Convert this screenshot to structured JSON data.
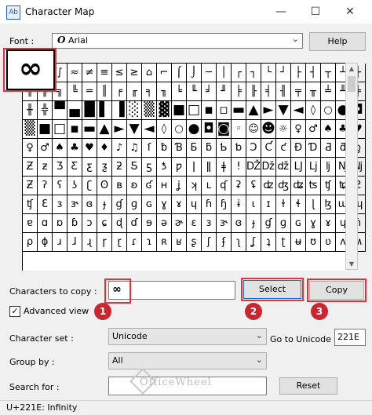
{
  "window": {
    "title": "Character Map",
    "app_icon": "character-map-icon",
    "controls": {
      "minimize": "—",
      "maximize": "☐"
    }
  },
  "font": {
    "label": "Font :",
    "value": "Arial",
    "font_icon": "O"
  },
  "help_label": "Help",
  "magnified_char": "∞",
  "grid_rows": [
    [
      "∞",
      "∩",
      "∫",
      "≈",
      "≠",
      "≡",
      "≤",
      "≥",
      "⌂",
      "⌐",
      "⌠",
      "⌡",
      "─",
      "│",
      "┌",
      "┐",
      "└",
      "┘",
      "├",
      "┤",
      "┬",
      "┴",
      "┼"
    ],
    [
      "╔",
      "╠",
      "╗",
      "╚",
      "═",
      "║",
      "╒",
      "╓",
      "╕",
      "╖",
      "╘",
      "╙",
      "╛",
      "╜",
      "╞",
      "╟",
      "╡",
      "╢",
      "╤",
      "╥",
      "╧",
      "╨",
      "╪"
    ],
    [
      "╫",
      "╬",
      "▀",
      "▄",
      "█",
      "▌",
      "▐",
      "░",
      "▒",
      "▓",
      "■",
      "□",
      "▪",
      "▫",
      "▬",
      "▲",
      "►",
      "▼",
      "◄",
      "◊",
      "○",
      "●",
      "◘"
    ],
    [
      "▒",
      "■",
      "□",
      "▪",
      "▬",
      "▲",
      "►",
      "▼",
      "◄",
      "◊",
      "○",
      "●",
      "◘",
      "◙",
      "◦",
      "☺",
      "☻",
      "☼",
      "♀",
      "♂",
      "♠",
      "♣",
      "♥"
    ],
    [
      "♀",
      "♂",
      "♠",
      "♣",
      "♥",
      "♦",
      "♪",
      "♫",
      "ſ",
      "ƀ",
      "Ɓ",
      "Ƃ",
      "ƃ",
      "Ƅ",
      "ƅ",
      "Ɔ",
      "Ƈ",
      "ƈ",
      "Ɖ",
      "Ɗ",
      "Ƌ",
      "ƌ",
      "ƍ"
    ],
    [
      "Ƶ",
      "ƶ",
      "Ʒ",
      "Ƹ",
      "ƹ",
      "ƺ",
      "ƻ",
      "Ƽ",
      "ƽ",
      "ƾ",
      "ƿ",
      "ǀ",
      "ǁ",
      "ǂ",
      "ǃ",
      "Ǆ",
      "ǅ",
      "ǆ",
      "Ǉ",
      "ǈ",
      "ǉ",
      "Ǌ",
      "ǋ"
    ],
    [
      "Ƶ",
      "ʔ",
      "ʕ",
      "ʖ",
      "ʗ",
      "ʘ",
      "ʙ",
      "ʚ",
      "ʛ",
      "ʜ",
      "ʝ",
      "ʞ",
      "ʟ",
      "ʠ",
      "ʡ",
      "ʢ",
      "ʣ",
      "ʤ",
      "ʥ",
      "ʦ",
      "ʧ",
      "ʨ",
      "Ƨ"
    ],
    [
      "ʧ",
      "Ɛ",
      "ɜ",
      "ɝ",
      "ɞ",
      "ɟ",
      "ɠ",
      "ɡ",
      "ɢ",
      "ɣ",
      "ɤ",
      "ɥ",
      "ɦ",
      "ɧ",
      "ɨ",
      "ɩ",
      "ɪ",
      "ɫ",
      "ɬ",
      "ɭ",
      "ɮ",
      "ɯ",
      "ɰ"
    ],
    [
      "ɐ",
      "ɑ",
      "ɒ",
      "ɓ",
      "ɔ",
      "ɕ",
      "ɖ",
      "ɗ",
      "ɘ",
      "ə",
      "ɚ",
      "ɛ",
      "ɜ",
      "ɝ",
      "ɞ",
      "ɟ",
      "ɠ",
      "ɡ",
      "ɢ",
      "ɣ",
      "ɤ",
      "ɥ",
      "ɦ"
    ],
    [
      "ρ",
      "ɸ",
      "ɹ",
      "ɺ",
      "ɻ",
      "ɼ",
      "ɽ",
      "ɾ",
      "ɿ",
      "ʀ",
      "ʁ",
      "ʂ",
      "ʃ",
      "ʄ",
      "ʅ",
      "ʆ",
      "ʇ",
      "ʈ",
      "ʉ",
      "ʊ",
      "ʋ",
      "ʌ",
      "ʍ"
    ]
  ],
  "copy": {
    "label": "Characters to copy :",
    "value": "∞",
    "select_label": "Select",
    "copy_label": "Copy"
  },
  "advanced_view": {
    "label": "Advanced view",
    "checked": "✓"
  },
  "charset": {
    "label": "Character set :",
    "value": "Unicode"
  },
  "goto_unicode": {
    "label": "Go to Unicode :",
    "value": "221E"
  },
  "groupby": {
    "label": "Group by :",
    "value": "All"
  },
  "search": {
    "label": "Search for :",
    "value": "",
    "reset_label": "Reset"
  },
  "status": "U+221E: Infinity",
  "badges": [
    "1",
    "2",
    "3"
  ],
  "watermark": "OfficeWheel",
  "accent_color": "#e0343c"
}
